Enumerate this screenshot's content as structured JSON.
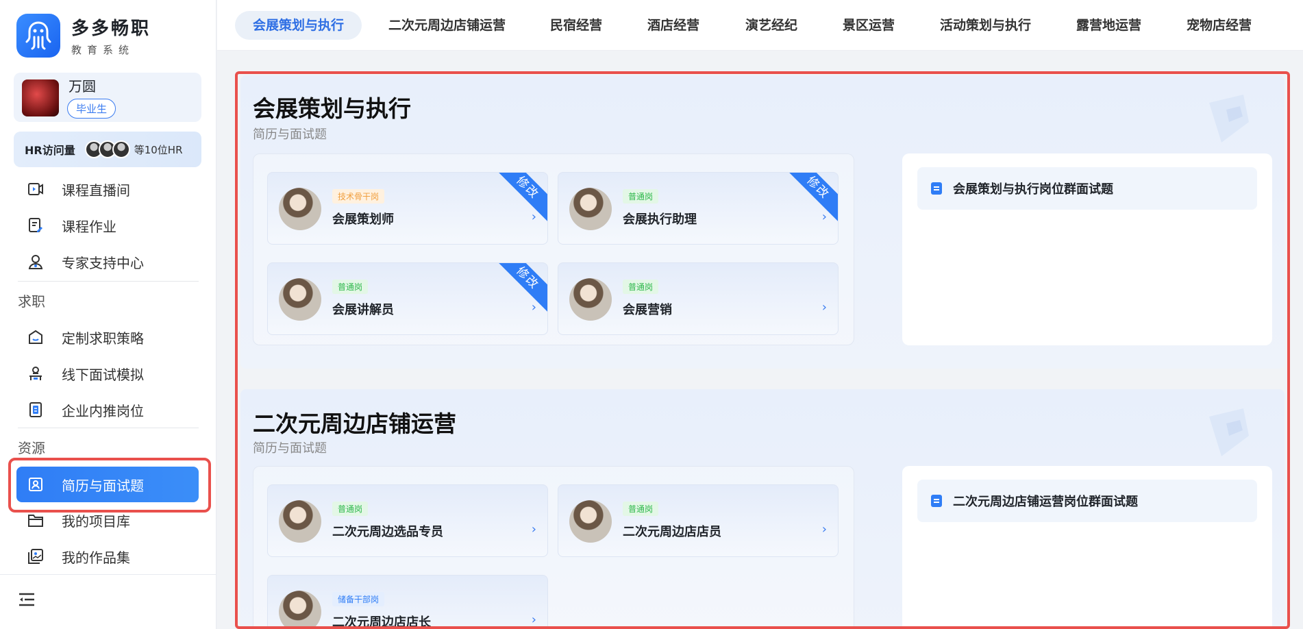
{
  "brand": {
    "title": "多多畅职",
    "subtitle": "教育系统"
  },
  "user": {
    "name": "万圆",
    "badge": "毕业生"
  },
  "hr": {
    "label": "HR访问量",
    "more": "等10位HR"
  },
  "nav": {
    "items_top": [
      {
        "label": "课程直播间",
        "icon": "live-video-icon"
      },
      {
        "label": "课程作业",
        "icon": "homework-icon"
      },
      {
        "label": "专家支持中心",
        "icon": "expert-icon"
      }
    ],
    "section_job": "求职",
    "items_job": [
      {
        "label": "定制求职策略",
        "icon": "strategy-icon"
      },
      {
        "label": "线下面试模拟",
        "icon": "interview-icon"
      },
      {
        "label": "企业内推岗位",
        "icon": "referral-icon"
      }
    ],
    "section_resource": "资源",
    "items_resource": [
      {
        "label": "简历与面试题",
        "icon": "resume-icon",
        "active": true
      },
      {
        "label": "我的项目库",
        "icon": "folder-icon"
      },
      {
        "label": "我的作品集",
        "icon": "portfolio-icon"
      }
    ]
  },
  "tabs": [
    "会展策划与执行",
    "二次元周边店铺运营",
    "民宿经营",
    "酒店经营",
    "演艺经纪",
    "景区运营",
    "活动策划与执行",
    "露营地运营",
    "宠物店经营"
  ],
  "sections": [
    {
      "title": "会展策划与执行",
      "subtitle": "简历与面试题",
      "jobs": [
        {
          "tag": "技术骨干岗",
          "name": "会展策划师",
          "ribbon": "修改"
        },
        {
          "tag": "普通岗",
          "name": "会展执行助理",
          "ribbon": "修改"
        },
        {
          "tag": "普通岗",
          "name": "会展讲解员",
          "ribbon": "修改"
        },
        {
          "tag": "普通岗",
          "name": "会展营销",
          "ribbon": ""
        }
      ],
      "interview": "会展策划与执行岗位群面试题"
    },
    {
      "title": "二次元周边店铺运营",
      "subtitle": "简历与面试题",
      "jobs": [
        {
          "tag": "普通岗",
          "name": "二次元周边选品专员",
          "ribbon": ""
        },
        {
          "tag": "普通岗",
          "name": "二次元周边店店员",
          "ribbon": ""
        },
        {
          "tag": "储备干部岗",
          "name": "二次元周边店店长",
          "ribbon": ""
        }
      ],
      "interview": "二次元周边店铺运营岗位群面试题"
    }
  ],
  "arrow": "›",
  "colors": {
    "accent": "#2f7df6",
    "highlight": "#e9504c"
  }
}
